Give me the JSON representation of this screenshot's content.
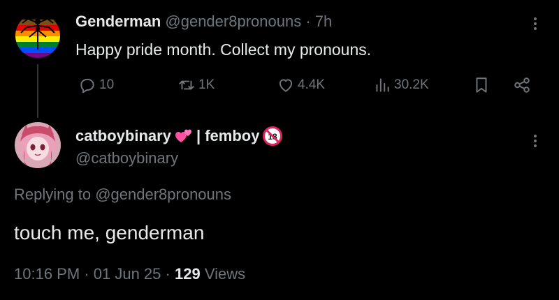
{
  "tweet1": {
    "display_name": "Genderman",
    "handle": "@gender8pronouns",
    "separator": "·",
    "time": "7h",
    "text": "Happy pride month. Collect my pronouns.",
    "stats": {
      "replies": "10",
      "reposts": "1K",
      "likes": "4.4K",
      "views": "30.2K"
    }
  },
  "tweet2": {
    "display_name": "catboybinary",
    "display_suffix": "| femboy",
    "handle": "@catboybinary",
    "replying_prefix": "Replying to",
    "replying_handle": "@gender8pronouns",
    "text": "touch me, genderman",
    "time": "10:16 PM",
    "dot1": "·",
    "date": "01 Jun 25",
    "dot2": "·",
    "views_count": "129",
    "views_label": "Views"
  },
  "colors": {
    "background": "#000000",
    "primary_text": "#e7e9ea",
    "secondary_text": "#71767b",
    "heart_pink": "#ff4fa3"
  },
  "icons": {
    "reply": "reply-icon",
    "repost": "repost-icon",
    "like": "heart-icon",
    "views": "views-icon",
    "bookmark": "bookmark-icon",
    "share": "share-icon",
    "more": "more-icon"
  }
}
